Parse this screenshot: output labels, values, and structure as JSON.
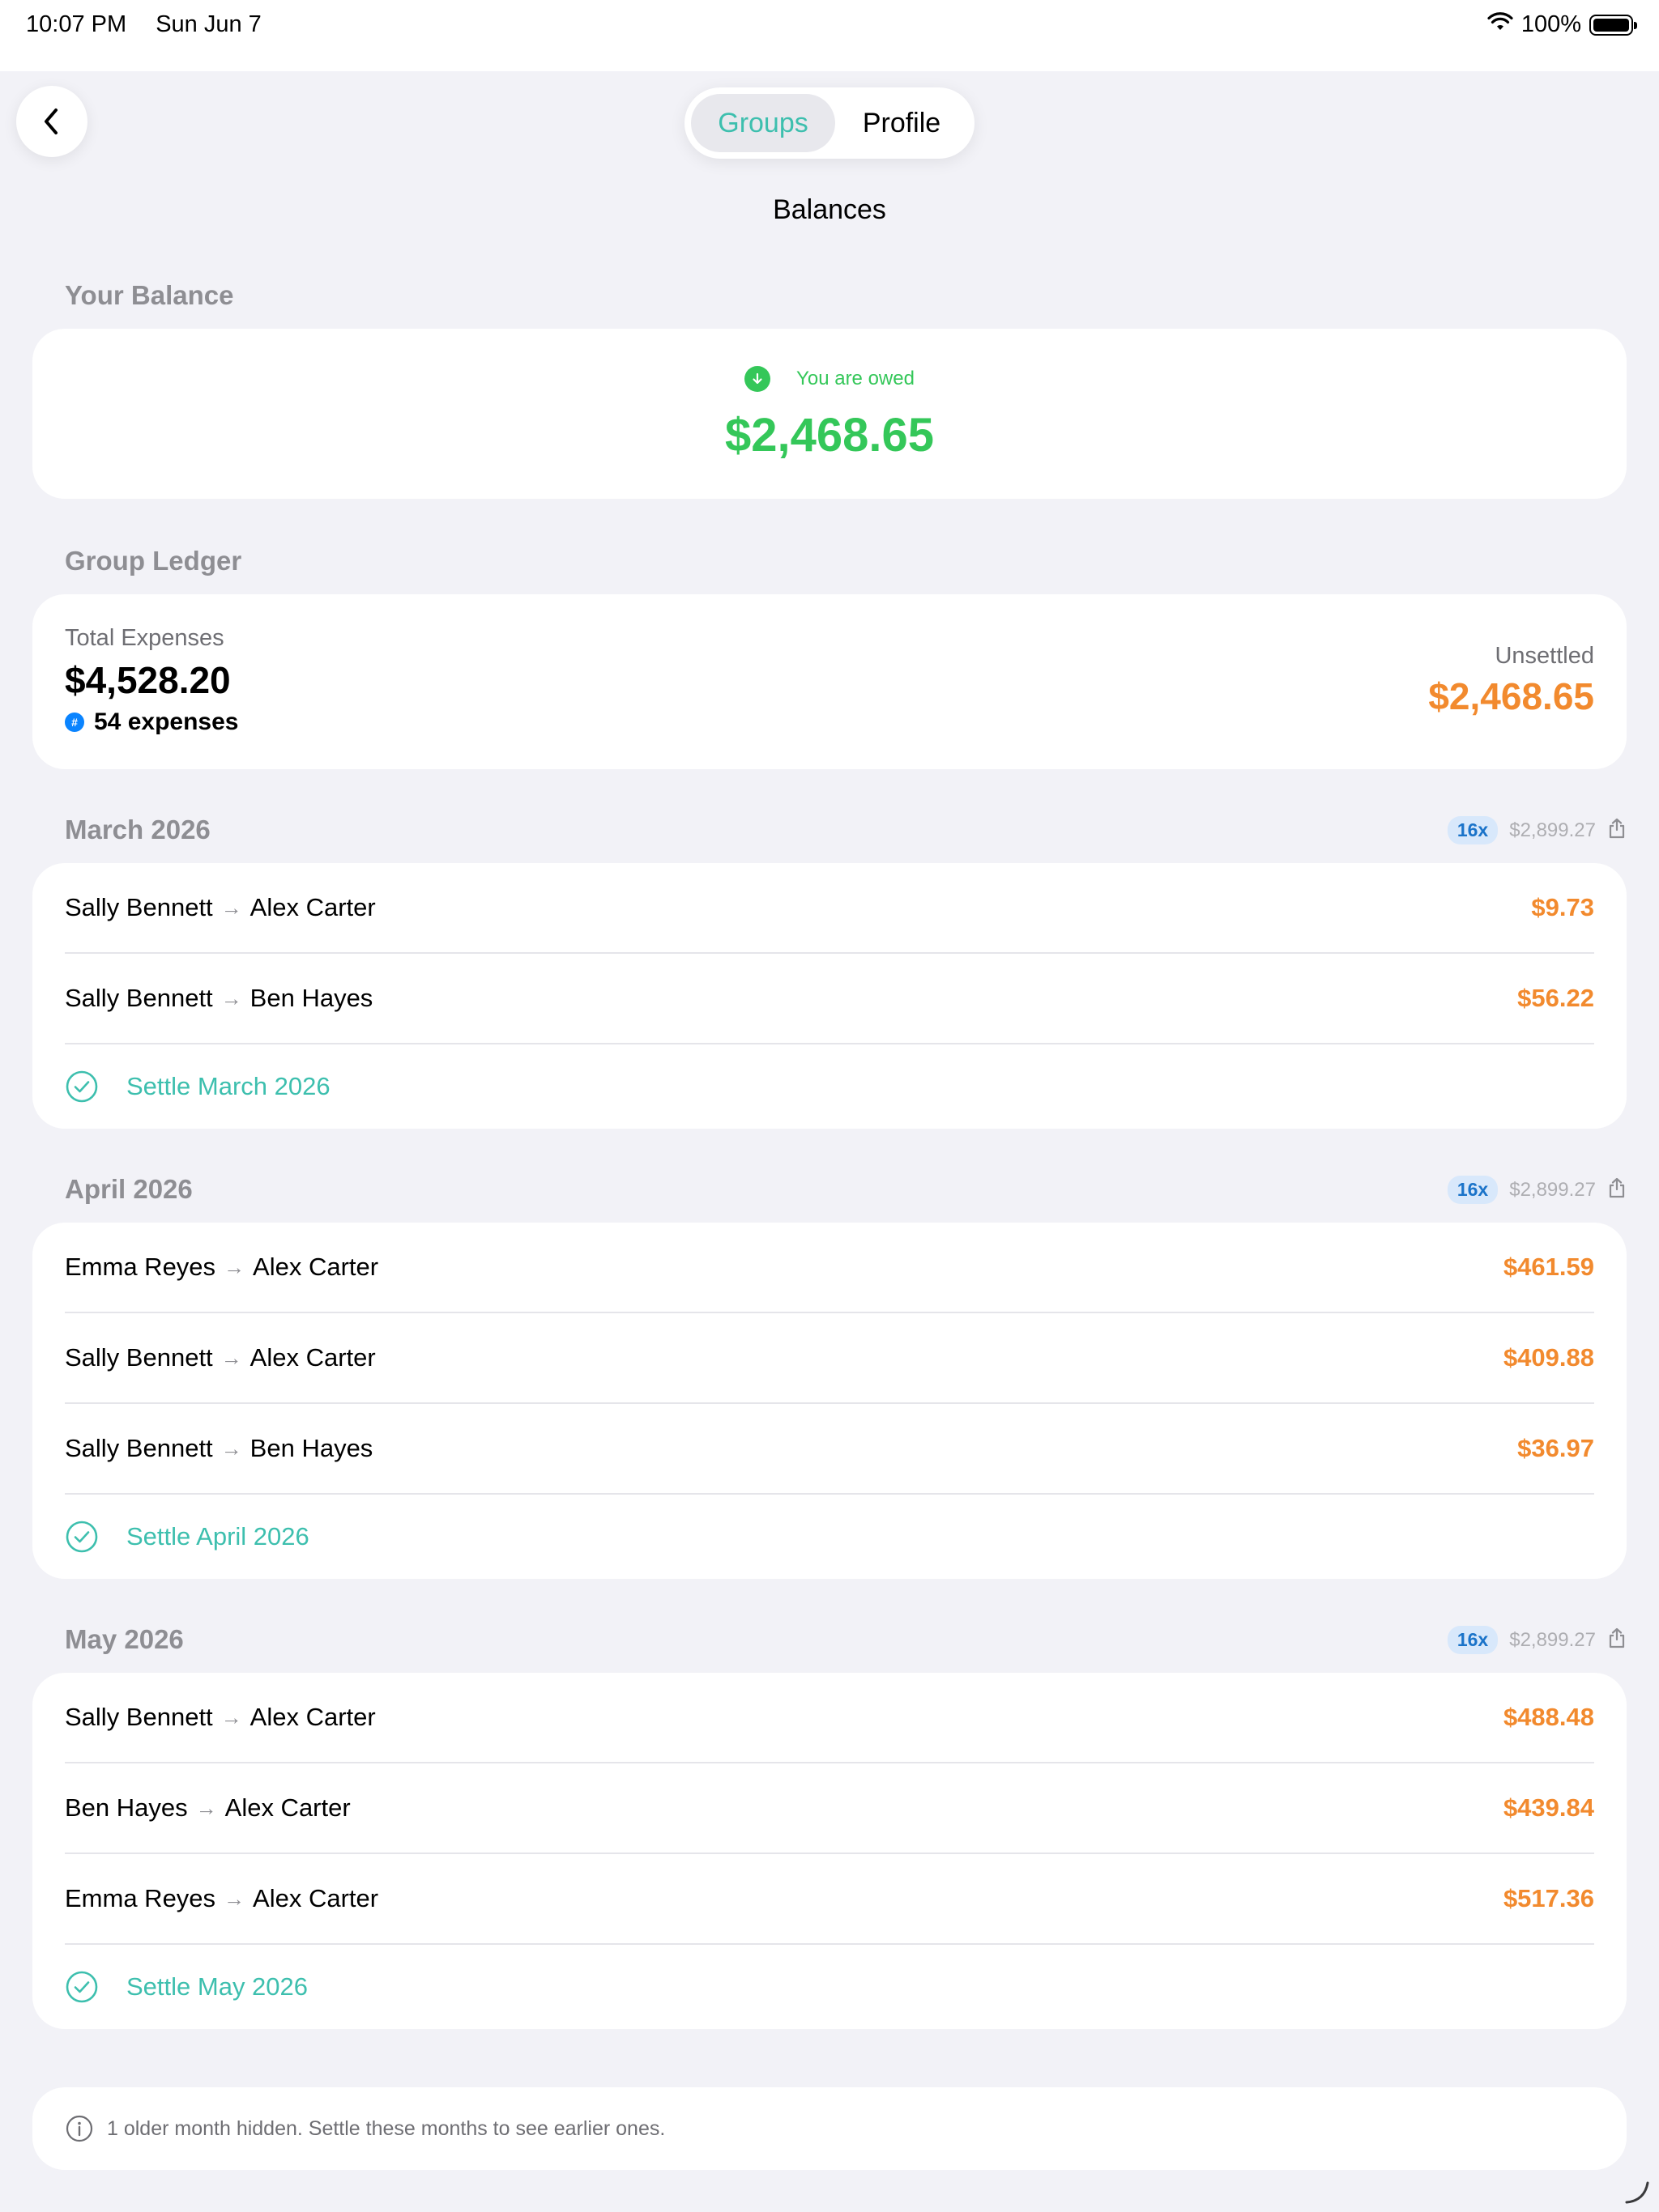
{
  "status_bar": {
    "time": "10:07 PM",
    "date": "Sun Jun 7",
    "battery": "100%"
  },
  "nav": {
    "tabs": [
      "Groups",
      "Profile"
    ],
    "active_tab": "Groups",
    "title": "Balances"
  },
  "your_balance": {
    "section_label": "Your Balance",
    "status": "You are owed",
    "amount": "$2,468.65"
  },
  "group_ledger": {
    "section_label": "Group Ledger",
    "total_label": "Total Expenses",
    "total": "$4,528.20",
    "expense_count": "54 expenses",
    "unsettled_label": "Unsettled",
    "unsettled": "$2,468.65"
  },
  "months": [
    {
      "title": "March 2026",
      "badge": "16x",
      "meta_amount": "$2,899.27",
      "rows": [
        {
          "from": "Sally Bennett",
          "to": "Alex Carter",
          "amount": "$9.73"
        },
        {
          "from": "Sally Bennett",
          "to": "Ben Hayes",
          "amount": "$56.22"
        }
      ],
      "settle_label": "Settle March 2026"
    },
    {
      "title": "April 2026",
      "badge": "16x",
      "meta_amount": "$2,899.27",
      "rows": [
        {
          "from": "Emma Reyes",
          "to": "Alex Carter",
          "amount": "$461.59"
        },
        {
          "from": "Sally Bennett",
          "to": "Alex Carter",
          "amount": "$409.88"
        },
        {
          "from": "Sally Bennett",
          "to": "Ben Hayes",
          "amount": "$36.97"
        }
      ],
      "settle_label": "Settle April 2026"
    },
    {
      "title": "May 2026",
      "badge": "16x",
      "meta_amount": "$2,899.27",
      "rows": [
        {
          "from": "Sally Bennett",
          "to": "Alex Carter",
          "amount": "$488.48"
        },
        {
          "from": "Ben Hayes",
          "to": "Alex Carter",
          "amount": "$439.84"
        },
        {
          "from": "Emma Reyes",
          "to": "Alex Carter",
          "amount": "$517.36"
        }
      ],
      "settle_label": "Settle May 2026"
    }
  ],
  "footer_note": "1 older month hidden. Settle these months to see earlier ones.",
  "colors": {
    "accent": "#3dbfae",
    "positive": "#34c759",
    "owed": "#f28a2e",
    "badge_bg": "#d8e8fb",
    "badge_text": "#1a73c9"
  }
}
